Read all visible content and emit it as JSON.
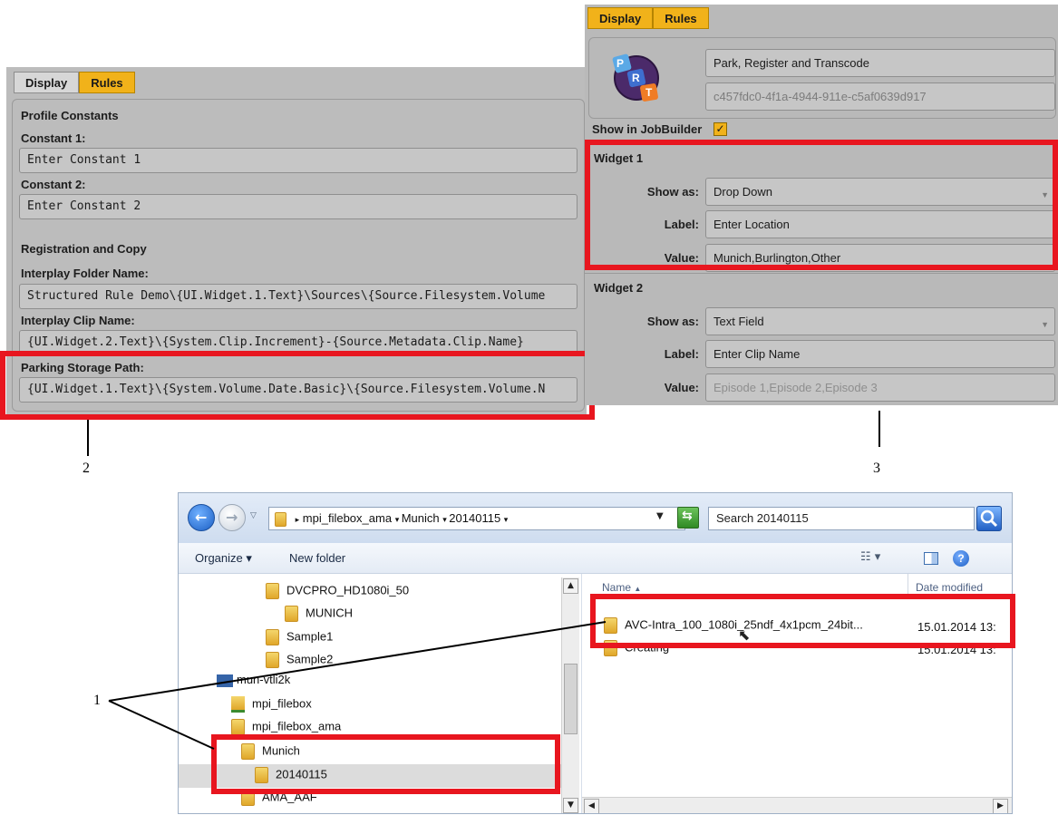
{
  "left_panel": {
    "tabs": [
      "Display",
      "Rules"
    ],
    "section_profile": "Profile Constants",
    "constant1_label": "Constant 1:",
    "constant1_value": "Enter Constant 1",
    "constant2_label": "Constant 2:",
    "constant2_value": "Enter Constant 2",
    "section_registration": "Registration and Copy",
    "folder_label": "Interplay Folder Name:",
    "folder_value": "Structured Rule Demo\\{UI.Widget.1.Text}\\Sources\\{Source.Filesystem.Volume",
    "clip_label": "Interplay Clip Name:",
    "clip_value": "{UI.Widget.2.Text}\\{System.Clip.Increment}-{Source.Metadata.Clip.Name}",
    "parking_label": "Parking Storage Path:",
    "parking_value": "{UI.Widget.1.Text}\\{System.Volume.Date.Basic}\\{Source.Filesystem.Volume.N"
  },
  "right_panel": {
    "tabs": [
      "Display",
      "Rules"
    ],
    "logo_letters": [
      "P",
      "R",
      "T"
    ],
    "profile_name": "Park, Register and Transcode",
    "profile_id": "c457fdc0-4f1a-4944-911e-c5af0639d917",
    "show_in_jobbuilder": "Show in JobBuilder",
    "show_checked": "✓",
    "widget1": {
      "title": "Widget 1",
      "show_as_label": "Show as:",
      "show_as_value": "Drop Down",
      "label_label": "Label:",
      "label_value": "Enter Location",
      "value_label": "Value:",
      "value_value": "Munich,Burlington,Other"
    },
    "widget2": {
      "title": "Widget 2",
      "show_as_label": "Show as:",
      "show_as_value": "Text Field",
      "label_label": "Label:",
      "label_value": "Enter Clip Name",
      "value_label": "Value:",
      "value_placeholder": "Episode 1,Episode 2,Episode 3"
    }
  },
  "explorer": {
    "breadcrumb": [
      "mpi_filebox_ama",
      "Munich",
      "20140115"
    ],
    "search_placeholder": "Search 20140115",
    "organize": "Organize",
    "new_folder": "New folder",
    "tree": [
      "DVCPRO_HD1080i_50",
      "MUNICH",
      "Sample1",
      "Sample2",
      "mun-vtli2k",
      "mpi_filebox",
      "mpi_filebox_ama",
      "Munich",
      "20140115",
      "AMA_AAF"
    ],
    "columns": {
      "name": "Name",
      "date": "Date modified"
    },
    "rows": [
      {
        "name": "AVC-Intra_100_1080i_25ndf_4x1pcm_24bit...",
        "date": "15.01.2014 13:"
      },
      {
        "name": "Creating",
        "date": "15.01.2014 13:"
      }
    ]
  },
  "callouts": [
    "1",
    "2",
    "3"
  ],
  "colors": {
    "highlight_red": "#e8161f",
    "active_tab": "#f1b21a",
    "panel_grey": "#bcbcbc"
  }
}
